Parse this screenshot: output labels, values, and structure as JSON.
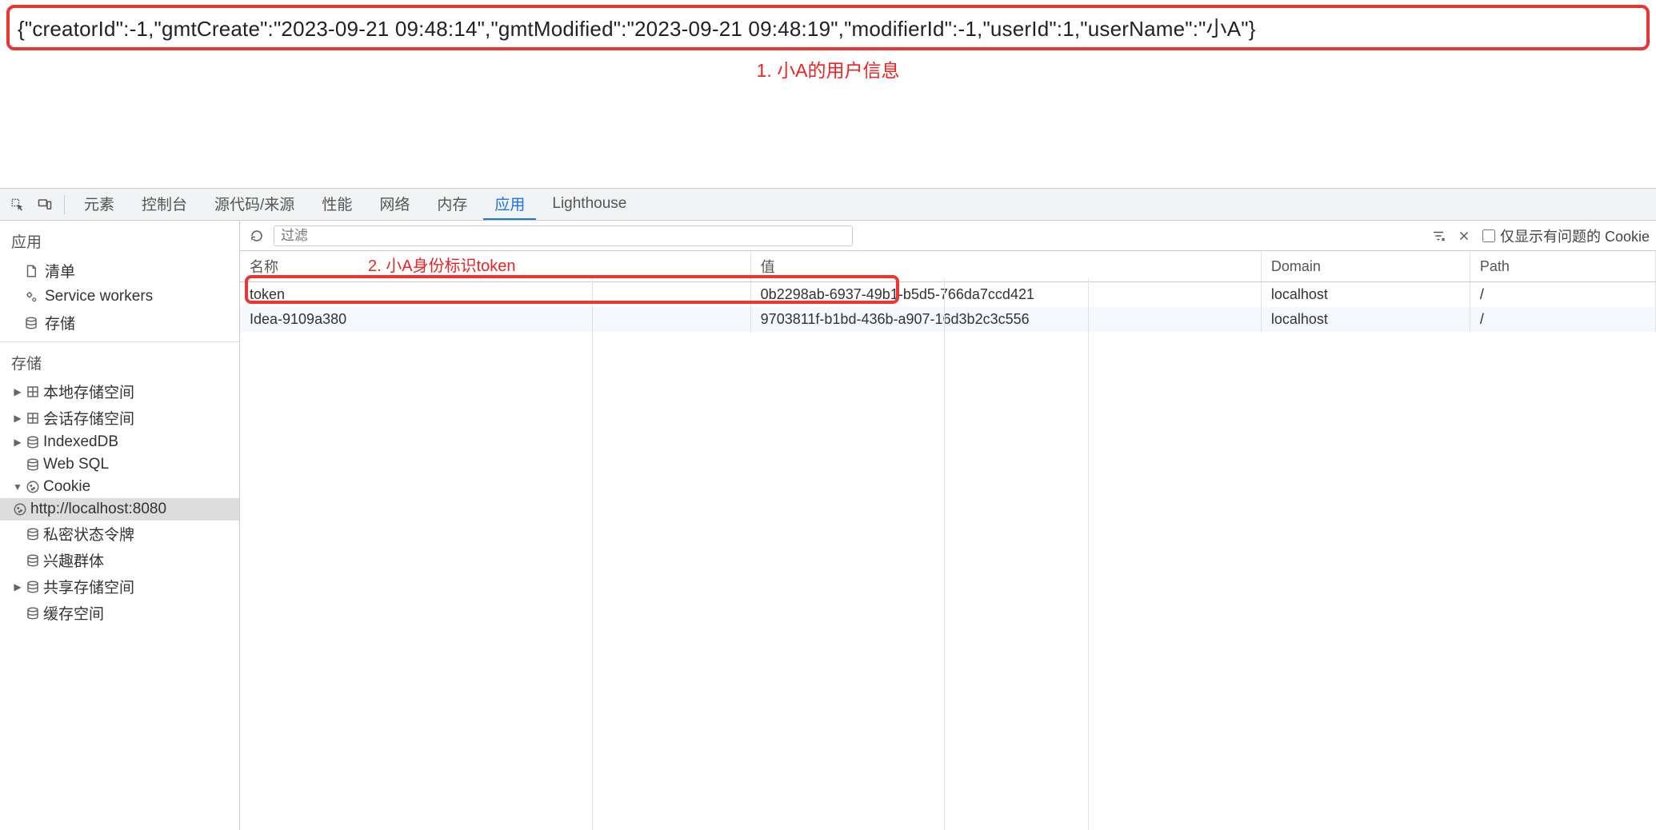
{
  "page": {
    "json_response": "{\"creatorId\":-1,\"gmtCreate\":\"2023-09-21 09:48:14\",\"gmtModified\":\"2023-09-21 09:48:19\",\"modifierId\":-1,\"userId\":1,\"userName\":\"小A\"}",
    "annotation_1": "1. 小A的用户信息",
    "annotation_2": "2. 小A身份标识token"
  },
  "devtools": {
    "tabs": [
      "元素",
      "控制台",
      "源代码/来源",
      "性能",
      "网络",
      "内存",
      "应用",
      "Lighthouse"
    ],
    "active_tab": "应用",
    "sidebar": {
      "section_app": "应用",
      "app_items": [
        "清单",
        "Service workers",
        "存储"
      ],
      "section_storage": "存储",
      "storage_tree": {
        "local": "本地存储空间",
        "session": "会话存储空间",
        "indexed": "IndexedDB",
        "websql": "Web SQL",
        "cookie": "Cookie",
        "cookie_child": "http://localhost:8080",
        "private": "私密状态令牌",
        "interest": "兴趣群体",
        "shared": "共享存储空间",
        "cache": "缓存空间"
      }
    },
    "toolbar": {
      "filter_placeholder": "过滤",
      "only_issue_label": "仅显示有问题的 Cookie"
    },
    "table": {
      "headers": {
        "name": "名称",
        "value": "值",
        "domain": "Domain",
        "path": "Path"
      },
      "rows": [
        {
          "name": "token",
          "value": "0b2298ab-6937-49b1-b5d5-766da7ccd421",
          "domain": "localhost",
          "path": "/"
        },
        {
          "name": "Idea-9109a380",
          "value": "9703811f-b1bd-436b-a907-16d3b2c3c556",
          "domain": "localhost",
          "path": "/"
        }
      ]
    }
  }
}
